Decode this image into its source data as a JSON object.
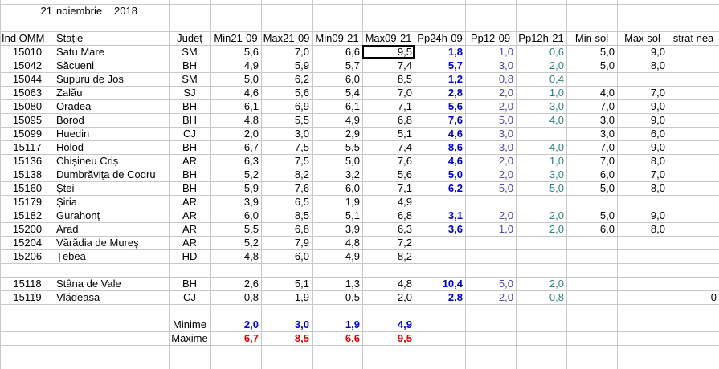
{
  "date": {
    "day": "21",
    "month": "noiembrie",
    "year": "2018"
  },
  "headers": [
    "Ind OMM",
    "Stație",
    "Județ",
    "Min21-09",
    "Max21-09",
    "Min09-21",
    "Max09-21",
    "Pp24h-09",
    "Pp12-09",
    "Pp12h-21",
    "Min sol",
    "Max sol",
    "strat nea"
  ],
  "rows": [
    [
      "15010",
      "Satu Mare",
      "SM",
      "5,6",
      "7,0",
      "6,6",
      "9,5",
      "1,8",
      "1,0",
      "0,6",
      "5,0",
      "9,0",
      ""
    ],
    [
      "15042",
      "Săcueni",
      "BH",
      "4,9",
      "5,9",
      "5,7",
      "7,4",
      "5,7",
      "3,0",
      "2,0",
      "5,0",
      "8,0",
      ""
    ],
    [
      "15044",
      "Supuru de Jos",
      "SM",
      "5,0",
      "6,2",
      "6,0",
      "8,5",
      "1,2",
      "0,8",
      "0,4",
      "",
      "",
      ""
    ],
    [
      "15063",
      "Zalău",
      "SJ",
      "4,6",
      "5,6",
      "5,4",
      "7,0",
      "2,8",
      "2,0",
      "1,0",
      "4,0",
      "7,0",
      ""
    ],
    [
      "15080",
      "Oradea",
      "BH",
      "6,1",
      "6,9",
      "6,1",
      "7,1",
      "5,6",
      "2,0",
      "3,0",
      "7,0",
      "9,0",
      ""
    ],
    [
      "15095",
      "Borod",
      "BH",
      "4,8",
      "5,5",
      "4,9",
      "6,8",
      "7,6",
      "5,0",
      "4,0",
      "3,0",
      "9,0",
      ""
    ],
    [
      "15099",
      "Huedin",
      "CJ",
      "2,0",
      "3,0",
      "2,9",
      "5,1",
      "4,6",
      "3,0",
      "",
      "3,0",
      "6,0",
      ""
    ],
    [
      "15117",
      "Holod",
      "BH",
      "6,7",
      "7,5",
      "5,5",
      "7,4",
      "8,6",
      "3,0",
      "4,0",
      "7,0",
      "9,0",
      ""
    ],
    [
      "15136",
      "Chișineu   Criș",
      "AR",
      "6,3",
      "7,5",
      "5,0",
      "7,6",
      "4,6",
      "2,0",
      "1,0",
      "7,0",
      "8,0",
      ""
    ],
    [
      "15138",
      "Dumbrăvița de Codru",
      "BH",
      "5,2",
      "8,2",
      "3,2",
      "5,6",
      "5,0",
      "2,0",
      "3,0",
      "6,0",
      "7,0",
      ""
    ],
    [
      "15160",
      "Ștei",
      "BH",
      "5,9",
      "7,6",
      "6,0",
      "7,1",
      "6,2",
      "5,0",
      "5,0",
      "5,0",
      "8,0",
      ""
    ],
    [
      "15179",
      "Șiria",
      "AR",
      "3,9",
      "6,5",
      "1,9",
      "4,9",
      "",
      "",
      "",
      "",
      "",
      ""
    ],
    [
      "15182",
      "Gurahonț",
      "AR",
      "6,0",
      "8,5",
      "5,1",
      "6,8",
      "3,1",
      "2,0",
      "2,0",
      "5,0",
      "9,0",
      ""
    ],
    [
      "15200",
      "Arad",
      "AR",
      "5,5",
      "6,8",
      "3,9",
      "6,3",
      "3,6",
      "1,0",
      "2,0",
      "6,0",
      "8,0",
      ""
    ],
    [
      "15204",
      "Vărădia de Mureș",
      "AR",
      "5,2",
      "7,9",
      "4,8",
      "7,2",
      "",
      "",
      "",
      "",
      "",
      ""
    ],
    [
      "15206",
      "Țebea",
      "HD",
      "4,8",
      "6,0",
      "4,9",
      "8,2",
      "",
      "",
      "",
      "",
      "",
      ""
    ],
    [
      "",
      "",
      "",
      "",
      "",
      "",
      "",
      "",
      "",
      "",
      "",
      "",
      ""
    ],
    [
      "15118",
      "Stâna de Vale",
      "BH",
      "2,6",
      "5,1",
      "1,3",
      "4,8",
      "10,4",
      "5,0",
      "2,0",
      "",
      "",
      ""
    ],
    [
      "15119",
      "Vlădeasa",
      "CJ",
      "0,8",
      "1,9",
      "-0,5",
      "2,0",
      "2,8",
      "2,0",
      "0,8",
      "",
      "",
      "0"
    ]
  ],
  "summary": {
    "min_label": "Minime",
    "max_label": "Maxime",
    "min_values": [
      "2,0",
      "3,0",
      "1,9",
      "4,9"
    ],
    "max_values": [
      "6,7",
      "8,5",
      "6,6",
      "9,5"
    ]
  },
  "selected_cell": {
    "row": 0,
    "column": "Max09-21"
  },
  "colors": {
    "grid": "#c8c8c8",
    "precip_24h": "#0000cc",
    "precip_12_09": "#4a4aa8",
    "precip_12h_21": "#2a8080",
    "maxima": "#dd0000"
  }
}
